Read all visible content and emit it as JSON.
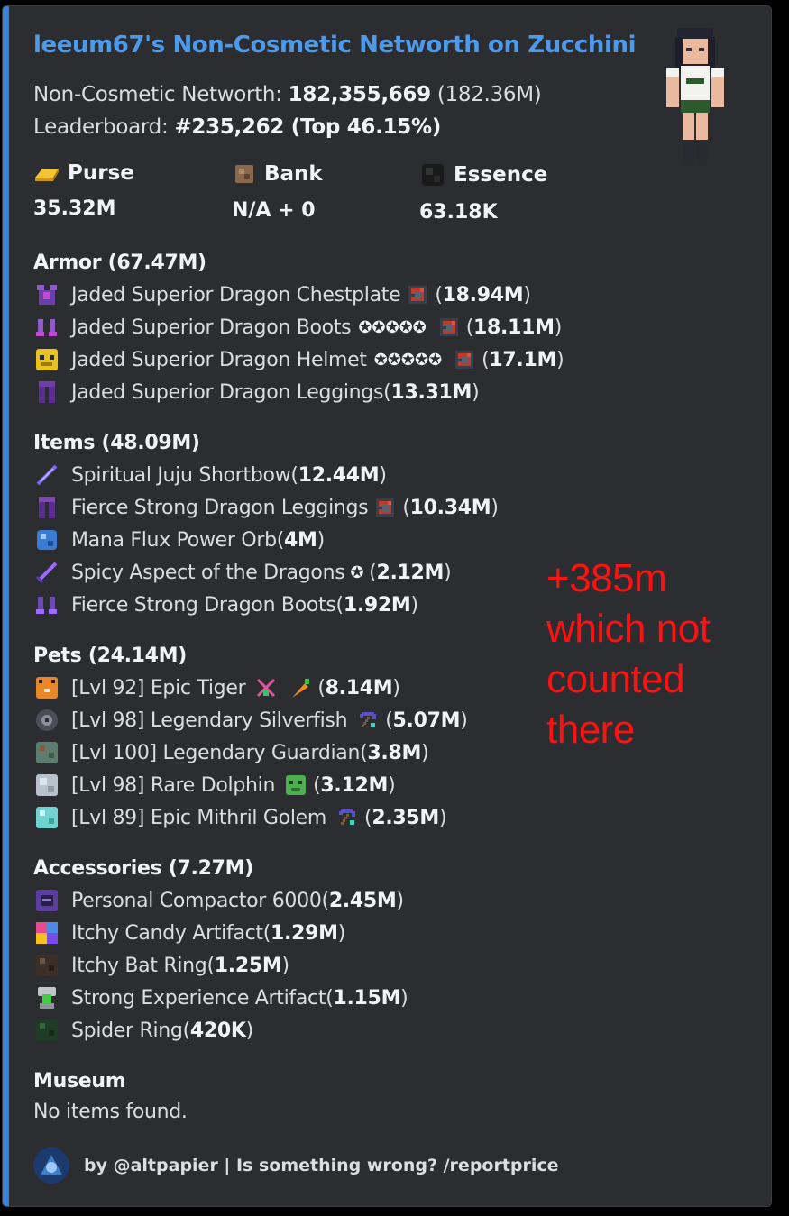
{
  "embed": {
    "title": "leeum67's Non-Cosmetic Networth on Zucchini",
    "networth_label": "Non-Cosmetic Networth: ",
    "networth_value": "182,355,669",
    "networth_short": " (182.36M)",
    "leaderboard_label": "Leaderboard: ",
    "leaderboard_rank": "#235,262",
    "leaderboard_top": " (Top 46.15%)",
    "fields": [
      {
        "name": "Purse",
        "value": "35.32M",
        "icon": "gold-ingot-icon"
      },
      {
        "name": "Bank",
        "value": "N/A + 0",
        "icon": "bank-bag-icon"
      },
      {
        "name": "Essence",
        "value": "63.18K",
        "icon": "wither-essence-icon"
      }
    ],
    "sections": {
      "armor": {
        "title": "Armor (67.47M)",
        "items": [
          {
            "name": "Jaded Superior Dragon Chestplate",
            "value": "18.94M",
            "stars": "",
            "gem": true,
            "icon": "chestplate-icon"
          },
          {
            "name": "Jaded Superior Dragon Boots",
            "value": "18.11M",
            "stars": "✪✪✪✪✪",
            "gem": true,
            "icon": "boots-icon"
          },
          {
            "name": "Jaded Superior Dragon Helmet",
            "value": "17.1M",
            "stars": "✪✪✪✪✪",
            "gem": true,
            "icon": "helmet-icon"
          },
          {
            "name": "Jaded Superior Dragon Leggings",
            "value": "13.31M",
            "stars": "",
            "gem": false,
            "icon": "leggings-icon"
          }
        ]
      },
      "items": {
        "title": "Items (48.09M)",
        "items": [
          {
            "name": "Spiritual Juju Shortbow",
            "value": "12.44M",
            "icon": "shortbow-icon"
          },
          {
            "name": "Fierce Strong Dragon Leggings",
            "value": "10.34M",
            "gem": true,
            "icon": "leggings-icon"
          },
          {
            "name": "Mana Flux Power Orb",
            "value": "4M",
            "icon": "power-orb-icon"
          },
          {
            "name": "Spicy Aspect of the Dragons",
            "value": "2.12M",
            "star": "✪",
            "icon": "sword-icon"
          },
          {
            "name": "Fierce Strong Dragon Boots",
            "value": "1.92M",
            "icon": "boots-icon"
          }
        ]
      },
      "pets": {
        "title": "Pets (24.14M)",
        "items": [
          {
            "name": "[Lvl 92] Epic Tiger",
            "value": "8.14M",
            "icon": "tiger-icon",
            "extras": [
              "sword-item-icon",
              "carrot-icon"
            ]
          },
          {
            "name": "[Lvl 98] Legendary Silverfish",
            "value": "5.07M",
            "icon": "silverfish-icon",
            "extras": [
              "pickaxe-icon"
            ]
          },
          {
            "name": "[Lvl 100] Legendary Guardian",
            "value": "3.8M",
            "icon": "guardian-icon",
            "extras": []
          },
          {
            "name": "[Lvl 98] Rare Dolphin",
            "value": "3.12M",
            "icon": "dolphin-icon",
            "extras": [
              "zombie-head-icon"
            ]
          },
          {
            "name": "[Lvl 89] Epic Mithril Golem",
            "value": "2.35M",
            "icon": "mithril-golem-icon",
            "extras": [
              "pickaxe-icon"
            ]
          }
        ]
      },
      "accessories": {
        "title": "Accessories (7.27M)",
        "items": [
          {
            "name": "Personal Compactor 6000",
            "value": "2.45M",
            "icon": "compactor-icon"
          },
          {
            "name": "Itchy Candy Artifact",
            "value": "1.29M",
            "icon": "candy-icon"
          },
          {
            "name": "Itchy Bat Ring",
            "value": "1.25M",
            "icon": "bat-ring-icon"
          },
          {
            "name": "Strong Experience Artifact",
            "value": "1.15M",
            "icon": "experience-artifact-icon"
          },
          {
            "name": "Spider Ring",
            "value": "420K",
            "icon": "spider-ring-icon"
          }
        ]
      },
      "museum": {
        "title": "Museum",
        "text": "No items found."
      }
    },
    "footer": "by @altpapier | Is something wrong? /reportprice"
  },
  "annotation": [
    "+385m",
    "which not",
    "counted",
    "there"
  ],
  "colors": {
    "accent": "#3b82d6",
    "title": "#4f9ae8",
    "background": "#2b2d31",
    "annotation": "#ff1111"
  }
}
